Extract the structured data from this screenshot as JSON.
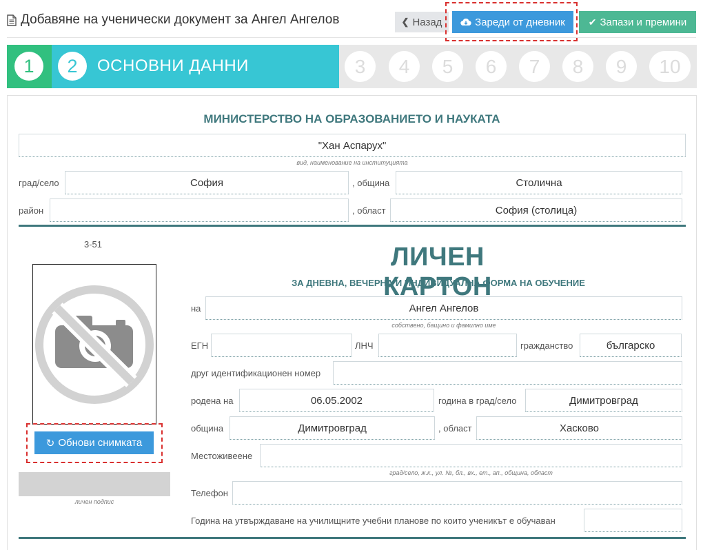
{
  "header": {
    "title": "Добавяне на ученически документ за Ангел Ангелов",
    "back_label": "Назад",
    "load_label": "Зареди от дневник",
    "save_label": "Запази и премини"
  },
  "steps": {
    "items": [
      "1",
      "2",
      "3",
      "4",
      "5",
      "6",
      "7",
      "8",
      "9",
      "10"
    ],
    "current_label": "ОСНОВНИ ДАННИ",
    "colors": {
      "done": "#31c07f",
      "current": "#37c6d4",
      "pending": "#e8e8e8"
    }
  },
  "institution": {
    "ministry": "МИНИСТЕРСТВО НА ОБРАЗОВАНИЕТО И НАУКАТА",
    "name": "\"Хан Аспарух\"",
    "name_hint": "вид, наименование на институцията",
    "city_label": "град/село",
    "city": "София",
    "municipality_label": ", община",
    "municipality": "Столична",
    "district_label": "район",
    "district": "",
    "region_label": ", област",
    "region": "София (столица)"
  },
  "card": {
    "number": "3-51",
    "title": "ЛИЧЕН КАРТОН",
    "subtitle": "ЗА ДНЕВНА, ВЕЧЕРНА И ИНДИВИДУАЛНА ФОРМА НА ОБУЧЕНИЕ",
    "update_photo_label": "Обнови снимката",
    "signature_hint": "личен подпис"
  },
  "student": {
    "name_label": "на",
    "name": "Ангел  Ангелов",
    "name_hint": "собствено, бащино и фамилно име",
    "egn_label": "ЕГН",
    "egn": "",
    "lnch_label": "ЛНЧ",
    "lnch": "",
    "citizenship_label": "гражданство",
    "citizenship": "българско",
    "other_id_label": "друг идентификационен номер",
    "other_id": "",
    "born_label": "родена на",
    "born": "06.05.2002",
    "born_city_label": "година в град/село",
    "born_city": "Димитровград",
    "municipality_label": "община",
    "municipality": "Димитровград",
    "region_label": ", област",
    "region": "Хасково",
    "address_label": "Местоживеене",
    "address": "",
    "address_hint": "град/село, ж.к., ул. №, бл., вх., ет., ап., община, област",
    "phone_label": "Телефон",
    "phone": "",
    "plans_label": "Година на утвърждаване на училищните учебни планове по които ученикът е обучаван",
    "plans_year": ""
  }
}
